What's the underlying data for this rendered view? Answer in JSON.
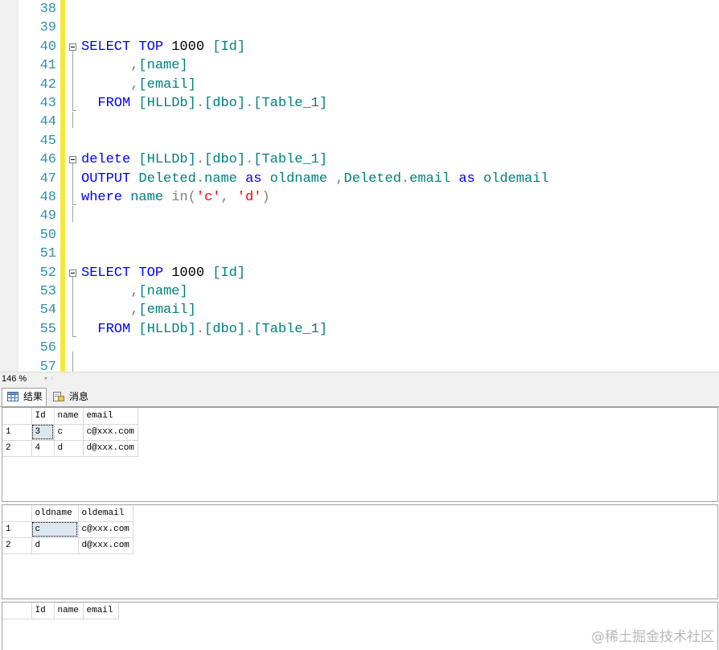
{
  "editor": {
    "line_numbers": [
      "38",
      "39",
      "40",
      "41",
      "42",
      "43",
      "44",
      "45",
      "46",
      "47",
      "48",
      "49",
      "50",
      "51",
      "52",
      "53",
      "54",
      "55",
      "56",
      "57"
    ],
    "lines": [
      [],
      [],
      [
        {
          "t": "SELECT",
          "c": "kw"
        },
        {
          "t": " ",
          "c": "bk"
        },
        {
          "t": "TOP",
          "c": "kw"
        },
        {
          "t": " 1000 ",
          "c": "bk"
        },
        {
          "t": "[Id]",
          "c": "id"
        }
      ],
      [
        {
          "t": "      ,",
          "c": "gr"
        },
        {
          "t": "[name]",
          "c": "id"
        }
      ],
      [
        {
          "t": "      ,",
          "c": "gr"
        },
        {
          "t": "[email]",
          "c": "id"
        }
      ],
      [
        {
          "t": "  ",
          "c": "bk"
        },
        {
          "t": "FROM",
          "c": "kw"
        },
        {
          "t": " ",
          "c": "bk"
        },
        {
          "t": "[HLLDb]",
          "c": "id"
        },
        {
          "t": ".",
          "c": "gr"
        },
        {
          "t": "[dbo]",
          "c": "id"
        },
        {
          "t": ".",
          "c": "gr"
        },
        {
          "t": "[Table_1]",
          "c": "id"
        }
      ],
      [],
      [],
      [
        {
          "t": "delete",
          "c": "kw"
        },
        {
          "t": " ",
          "c": "bk"
        },
        {
          "t": "[HLLDb]",
          "c": "id"
        },
        {
          "t": ".",
          "c": "gr"
        },
        {
          "t": "[dbo]",
          "c": "id"
        },
        {
          "t": ".",
          "c": "gr"
        },
        {
          "t": "[Table_1]",
          "c": "id"
        }
      ],
      [
        {
          "t": "OUTPUT",
          "c": "kw"
        },
        {
          "t": " ",
          "c": "bk"
        },
        {
          "t": "Deleted",
          "c": "id"
        },
        {
          "t": ".",
          "c": "gr"
        },
        {
          "t": "name",
          "c": "id"
        },
        {
          "t": " ",
          "c": "bk"
        },
        {
          "t": "as",
          "c": "kw"
        },
        {
          "t": " ",
          "c": "bk"
        },
        {
          "t": "oldname",
          "c": "id"
        },
        {
          "t": " ,",
          "c": "gr"
        },
        {
          "t": "Deleted",
          "c": "id"
        },
        {
          "t": ".",
          "c": "gr"
        },
        {
          "t": "email",
          "c": "id"
        },
        {
          "t": " ",
          "c": "bk"
        },
        {
          "t": "as",
          "c": "kw"
        },
        {
          "t": " ",
          "c": "bk"
        },
        {
          "t": "oldemail",
          "c": "id"
        }
      ],
      [
        {
          "t": "where",
          "c": "kw"
        },
        {
          "t": " ",
          "c": "bk"
        },
        {
          "t": "name",
          "c": "id"
        },
        {
          "t": " ",
          "c": "bk"
        },
        {
          "t": "in",
          "c": "gr"
        },
        {
          "t": "(",
          "c": "gr"
        },
        {
          "t": "'c'",
          "c": "st"
        },
        {
          "t": ", ",
          "c": "gr"
        },
        {
          "t": "'d'",
          "c": "st"
        },
        {
          "t": ")",
          "c": "gr"
        }
      ],
      [],
      [],
      [],
      [
        {
          "t": "SELECT",
          "c": "kw"
        },
        {
          "t": " ",
          "c": "bk"
        },
        {
          "t": "TOP",
          "c": "kw"
        },
        {
          "t": " 1000 ",
          "c": "bk"
        },
        {
          "t": "[Id]",
          "c": "id"
        }
      ],
      [
        {
          "t": "      ,",
          "c": "gr"
        },
        {
          "t": "[name]",
          "c": "id"
        }
      ],
      [
        {
          "t": "      ,",
          "c": "gr"
        },
        {
          "t": "[email]",
          "c": "id"
        }
      ],
      [
        {
          "t": "  ",
          "c": "bk"
        },
        {
          "t": "FROM",
          "c": "kw"
        },
        {
          "t": " ",
          "c": "bk"
        },
        {
          "t": "[HLLDb]",
          "c": "id"
        },
        {
          "t": ".",
          "c": "gr"
        },
        {
          "t": "[dbo]",
          "c": "id"
        },
        {
          "t": ".",
          "c": "gr"
        },
        {
          "t": "[Table_1]",
          "c": "id"
        }
      ],
      [],
      []
    ],
    "colors": {
      "keyword": "#0000ff",
      "identifier": "#008080",
      "operator": "#808080",
      "string": "#ff0000",
      "line_number": "#2b91af",
      "change_bar": "#f7e935"
    }
  },
  "zoom": {
    "value": "146 %"
  },
  "tabs": [
    {
      "label": "结果",
      "icon": "grid-icon",
      "active": true
    },
    {
      "label": "消息",
      "icon": "message-icon",
      "active": false
    }
  ],
  "results": [
    {
      "columns": [
        "Id",
        "name",
        "email"
      ],
      "rows": [
        [
          "1",
          "3",
          "c",
          "c@xxx.com"
        ],
        [
          "2",
          "4",
          "d",
          "d@xxx.com"
        ]
      ]
    },
    {
      "columns": [
        "oldname",
        "oldemail"
      ],
      "rows": [
        [
          "1",
          "c",
          "c@xxx.com"
        ],
        [
          "2",
          "d",
          "d@xxx.com"
        ]
      ]
    },
    {
      "columns": [
        "Id",
        "name",
        "email"
      ],
      "rows": []
    }
  ],
  "watermark": "@稀土掘金技术社区"
}
